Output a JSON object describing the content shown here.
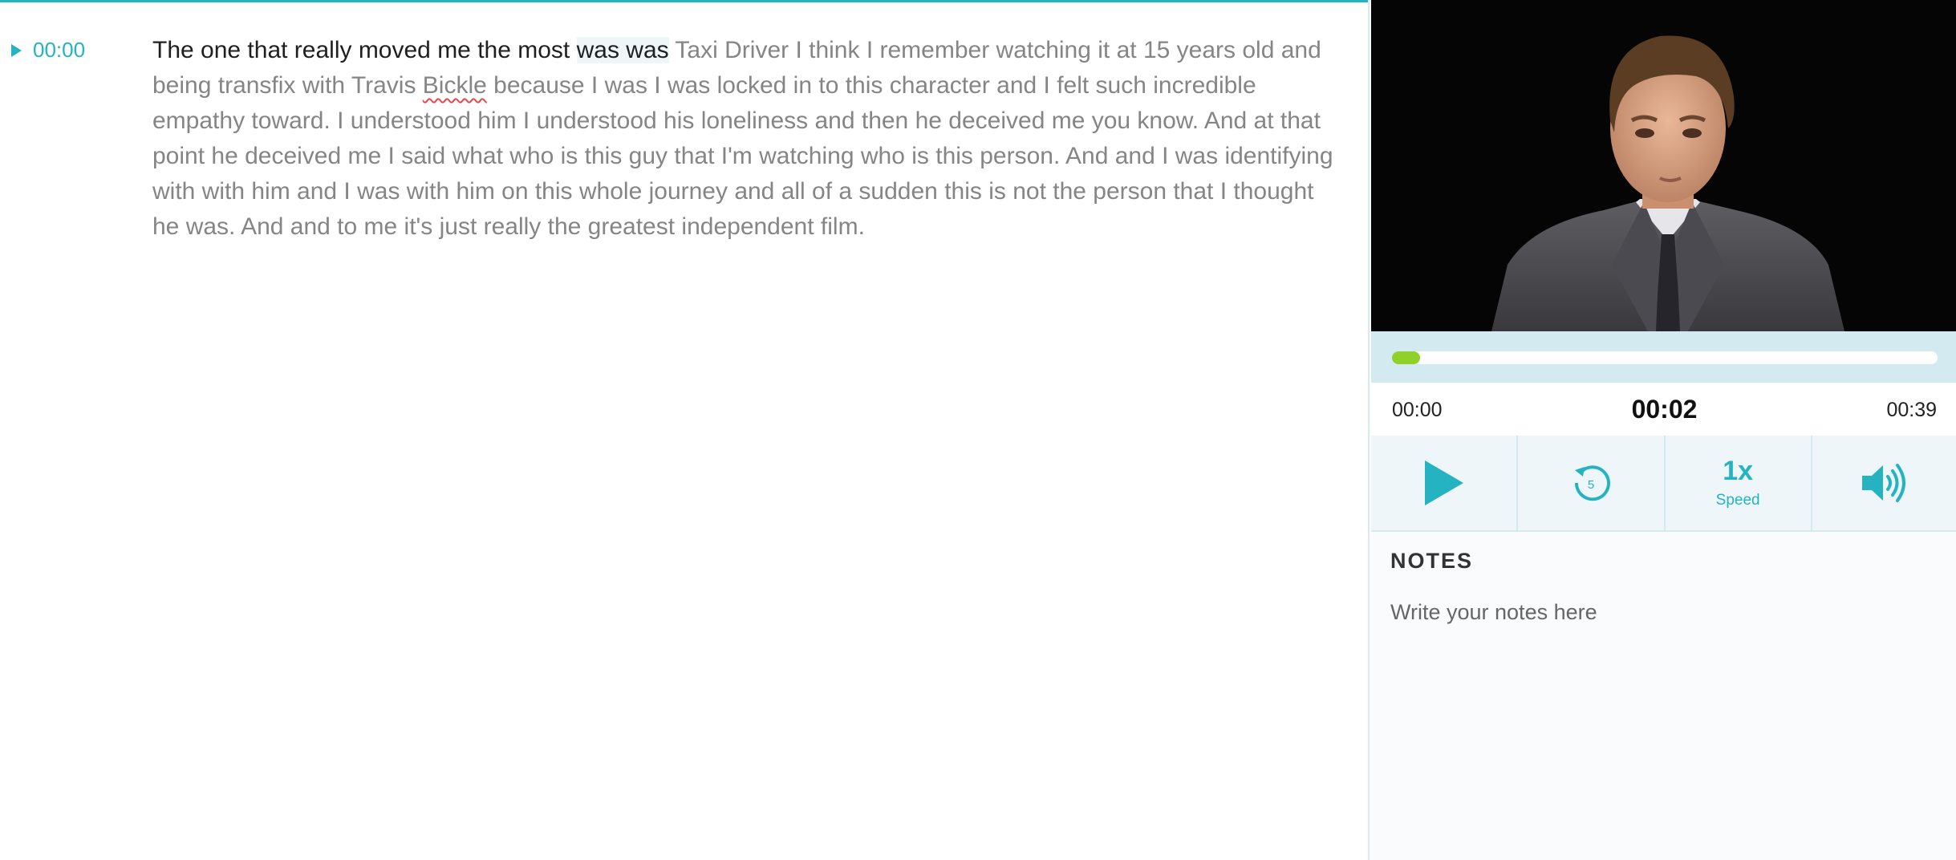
{
  "transcript": {
    "timestamp": "00:00",
    "spoken_text": "The one that really moved me the most ",
    "current_words": "was was",
    "unspoken_a": " Taxi Driver I think I remember watching it at 15 years old and being transfix with Travis ",
    "misspelled_word": "Bickle",
    "unspoken_b": " because I was I was locked in to this character and I felt such incredible empathy toward. I understood him I understood his loneliness and then he deceived me you know. And at that point he deceived me I said what who is this guy that I'm watching who is this person. And and I was identifying with with him and I was with him on this whole journey and all of a sudden this is not the person that I thought he was. And and to me it's just really the greatest independent film."
  },
  "player": {
    "time_start": "00:00",
    "time_current": "00:02",
    "time_end": "00:39",
    "progress_fraction": 0.0513,
    "progress_color": "#8fd12a",
    "accent_color": "#25b3c1",
    "play_icon": "play-icon",
    "rewind_icon": "rewind-5-icon",
    "rewind_seconds": "5",
    "speed_value": "1x",
    "speed_label": "Speed",
    "volume_icon": "volume-icon"
  },
  "notes": {
    "title": "NOTES",
    "placeholder": "Write your notes here"
  }
}
